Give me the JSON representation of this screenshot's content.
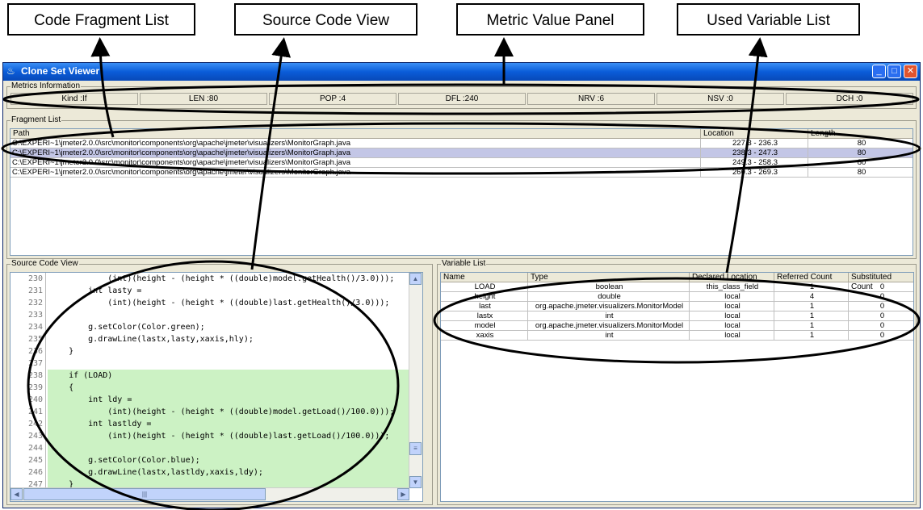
{
  "callouts": {
    "code_fragment_list": "Code Fragment List",
    "source_code_view": "Source Code View",
    "metric_value_panel": "Metric Value Panel",
    "used_variable_list": "Used Variable List"
  },
  "window": {
    "title": "Clone Set Viewer",
    "buttons": {
      "minimize": "_",
      "maximize": "□",
      "close": "✕"
    }
  },
  "metrics": {
    "label": "Metrics Information",
    "items": [
      "Kind :If",
      "LEN :80",
      "POP :4",
      "DFL :240",
      "NRV :6",
      "NSV :0",
      "DCH :0"
    ]
  },
  "fragments": {
    "label": "Fragment List",
    "columns": [
      "Path",
      "Location",
      "Length"
    ],
    "rows": [
      {
        "path": "C:\\EXPERI~1\\jmeter2.0.0\\src\\monitor\\components\\org\\apache\\jmeter\\visualizers\\MonitorGraph.java",
        "location": "227.3 - 236.3",
        "length": "80"
      },
      {
        "path": "C:\\EXPERI~1\\jmeter2.0.0\\src\\monitor\\components\\org\\apache\\jmeter\\visualizers\\MonitorGraph.java",
        "location": "238.3 - 247.3",
        "length": "80"
      },
      {
        "path": "C:\\EXPERI~1\\jmeter2.0.0\\src\\monitor\\components\\org\\apache\\jmeter\\visualizers\\MonitorGraph.java",
        "location": "249.3 - 258.3",
        "length": "80"
      },
      {
        "path": "C:\\EXPERI~1\\jmeter2.0.0\\src\\monitor\\components\\org\\apache\\jmeter\\visualizers\\MonitorGraph.java",
        "location": "260.3 - 269.3",
        "length": "80"
      }
    ]
  },
  "source": {
    "label": "Source Code View",
    "lines": [
      {
        "n": "230",
        "t": "            (int)(height - (height * ((double)model.getHealth()/3.0)));",
        "hl": false
      },
      {
        "n": "231",
        "t": "        int lasty =",
        "hl": false
      },
      {
        "n": "232",
        "t": "            (int)(height - (height * ((double)last.getHealth()/3.0)));",
        "hl": false
      },
      {
        "n": "233",
        "t": "",
        "hl": false
      },
      {
        "n": "234",
        "t": "        g.setColor(Color.green);",
        "hl": false
      },
      {
        "n": "235",
        "t": "        g.drawLine(lastx,lasty,xaxis,hly);",
        "hl": false
      },
      {
        "n": "236",
        "t": "    }",
        "hl": false
      },
      {
        "n": "237",
        "t": "",
        "hl": false
      },
      {
        "n": "238",
        "t": "    if (LOAD)",
        "hl": true
      },
      {
        "n": "239",
        "t": "    {",
        "hl": true
      },
      {
        "n": "240",
        "t": "        int ldy =",
        "hl": true
      },
      {
        "n": "241",
        "t": "            (int)(height - (height * ((double)model.getLoad()/100.0)));",
        "hl": true
      },
      {
        "n": "242",
        "t": "        int lastldy =",
        "hl": true
      },
      {
        "n": "243",
        "t": "            (int)(height - (height * ((double)last.getLoad()/100.0)));",
        "hl": true
      },
      {
        "n": "244",
        "t": "",
        "hl": true
      },
      {
        "n": "245",
        "t": "        g.setColor(Color.blue);",
        "hl": true
      },
      {
        "n": "246",
        "t": "        g.drawLine(lastx,lastldy,xaxis,ldy);",
        "hl": true
      },
      {
        "n": "247",
        "t": "    }",
        "hl": true
      }
    ]
  },
  "variables": {
    "label": "Variable List",
    "columns": [
      "Name",
      "Type",
      "Declared Location",
      "Referred Count",
      "Substituted Count"
    ],
    "rows": [
      [
        "LOAD",
        "boolean",
        "this_class_field",
        "1",
        "0"
      ],
      [
        "height",
        "double",
        "local",
        "4",
        "0"
      ],
      [
        "last",
        "org.apache.jmeter.visualizers.MonitorModel",
        "local",
        "1",
        "0"
      ],
      [
        "lastx",
        "int",
        "local",
        "1",
        "0"
      ],
      [
        "model",
        "org.apache.jmeter.visualizers.MonitorModel",
        "local",
        "1",
        "0"
      ],
      [
        "xaxis",
        "int",
        "local",
        "1",
        "0"
      ]
    ]
  }
}
